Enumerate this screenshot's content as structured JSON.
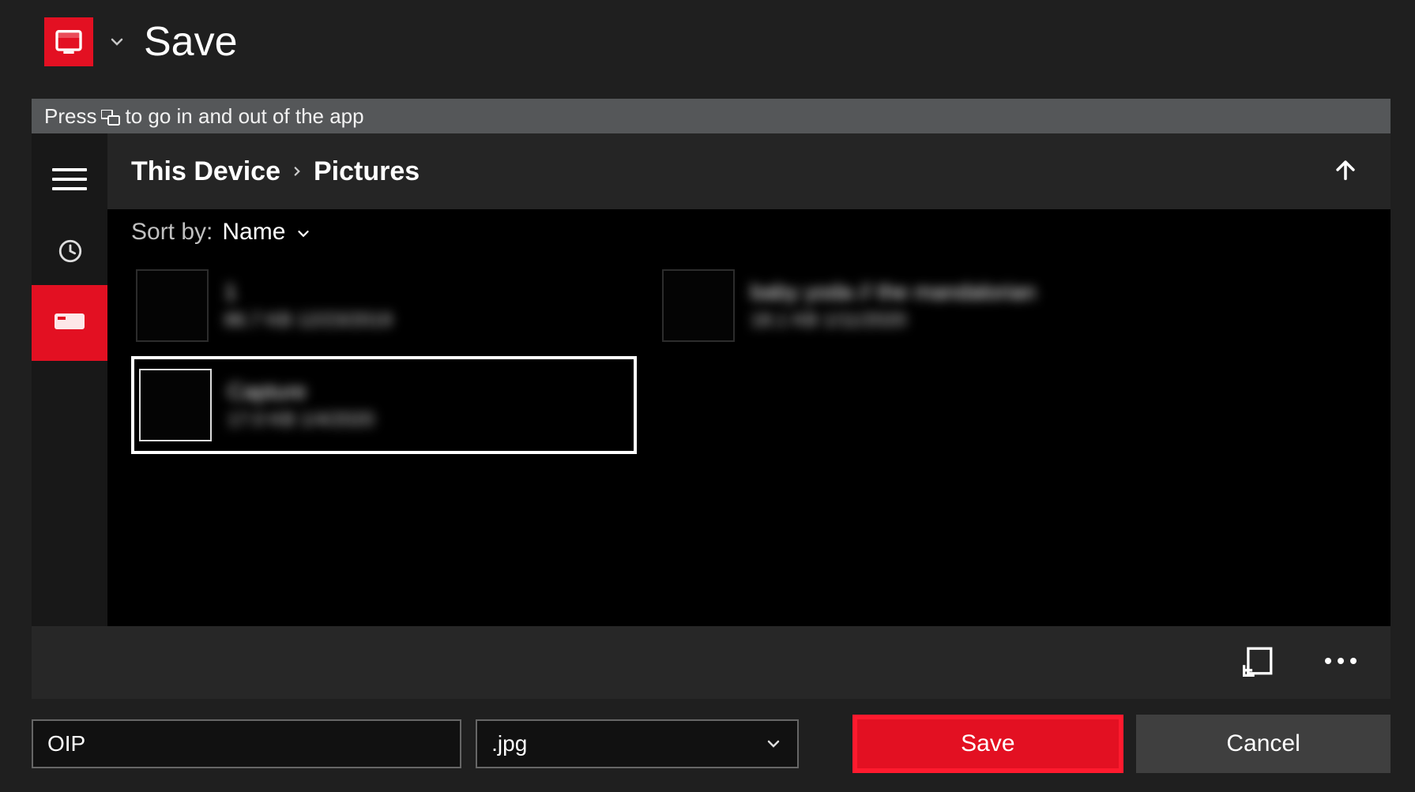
{
  "titlebar": {
    "title": "Save"
  },
  "hint": {
    "prefix": "Press",
    "suffix": "to go in and out of the app"
  },
  "breadcrumb": {
    "root": "This Device",
    "leaf": "Pictures"
  },
  "sort": {
    "label": "Sort by:",
    "value": "Name"
  },
  "files": [
    {
      "name": "1",
      "meta": "86.7 KB  12/23/2019",
      "selected": false
    },
    {
      "name": "baby yoda // the mandalorian",
      "meta": "18.1 KB  1/11/2020",
      "selected": false
    },
    {
      "name": "Capture",
      "meta": "17.0 KB  1/4/2020",
      "selected": true
    }
  ],
  "filename": {
    "value": "OIP"
  },
  "extension": {
    "value": ".jpg"
  },
  "buttons": {
    "save": "Save",
    "cancel": "Cancel"
  }
}
